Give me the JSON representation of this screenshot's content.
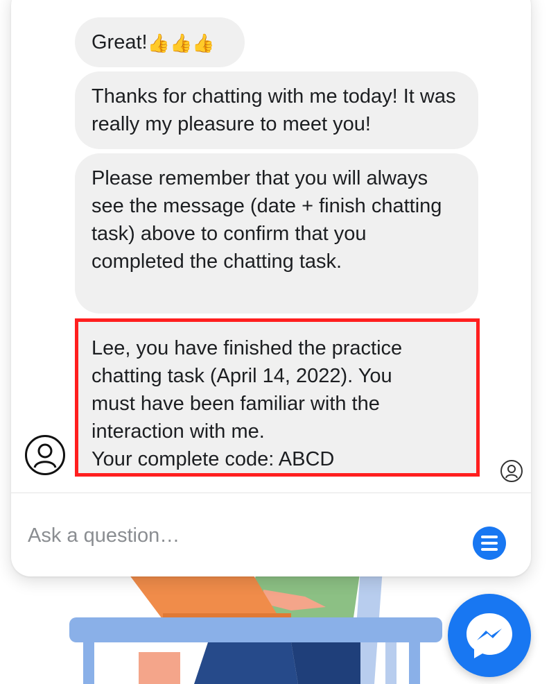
{
  "chat": {
    "messages": [
      {
        "text": "Great!",
        "emoji": [
          "👍",
          "👍",
          "👍"
        ]
      },
      {
        "text": "Thanks for chatting with me today! It was really my pleasure to meet you!"
      },
      {
        "text": "Please remember that you will always see the message (date + finish chatting task) above to confirm that you completed the chatting task."
      },
      {
        "lines": [
          "Lee, you have finished the practice",
          "chatting task (April 14, 2022). You",
          "must have been familiar with the",
          "interaction with me.",
          "Your complete code: ABCD"
        ],
        "highlighted": true
      }
    ],
    "input": {
      "placeholder": "Ask a question…",
      "value": ""
    }
  },
  "icons": {
    "bot_avatar": "user-circle-icon",
    "user_avatar": "user-circle-icon",
    "menu": "menu-icon",
    "messenger": "messenger-icon"
  },
  "colors": {
    "accent": "#1877f2",
    "bubble": "#f0f0f0",
    "highlight_border": "#ff1f1f"
  }
}
